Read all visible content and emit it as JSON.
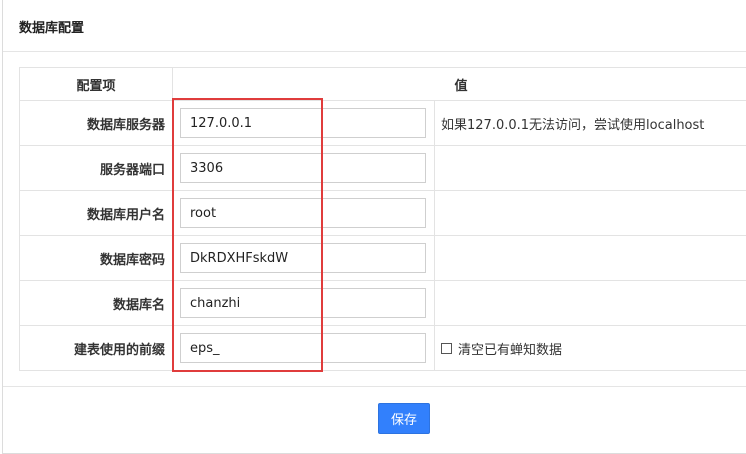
{
  "panel": {
    "title": "数据库配置"
  },
  "table": {
    "headers": {
      "item": "配置项",
      "value": "值"
    },
    "rows": [
      {
        "label": "数据库服务器",
        "value": "127.0.0.1",
        "hint": "如果127.0.0.1无法访问，尝试使用localhost"
      },
      {
        "label": "服务器端口",
        "value": "3306",
        "hint": ""
      },
      {
        "label": "数据库用户名",
        "value": "root",
        "hint": ""
      },
      {
        "label": "数据库密码",
        "value": "DkRDXHFskdW",
        "hint": ""
      },
      {
        "label": "数据库名",
        "value": "chanzhi",
        "hint": ""
      },
      {
        "label": "建表使用的前缀",
        "value": "eps_",
        "checkbox_label": "清空已有蝉知数据",
        "checkbox_checked": false
      }
    ]
  },
  "footer": {
    "save_label": "保存"
  },
  "colors": {
    "accent": "#3280fc",
    "highlight_border": "#e03c3c"
  }
}
